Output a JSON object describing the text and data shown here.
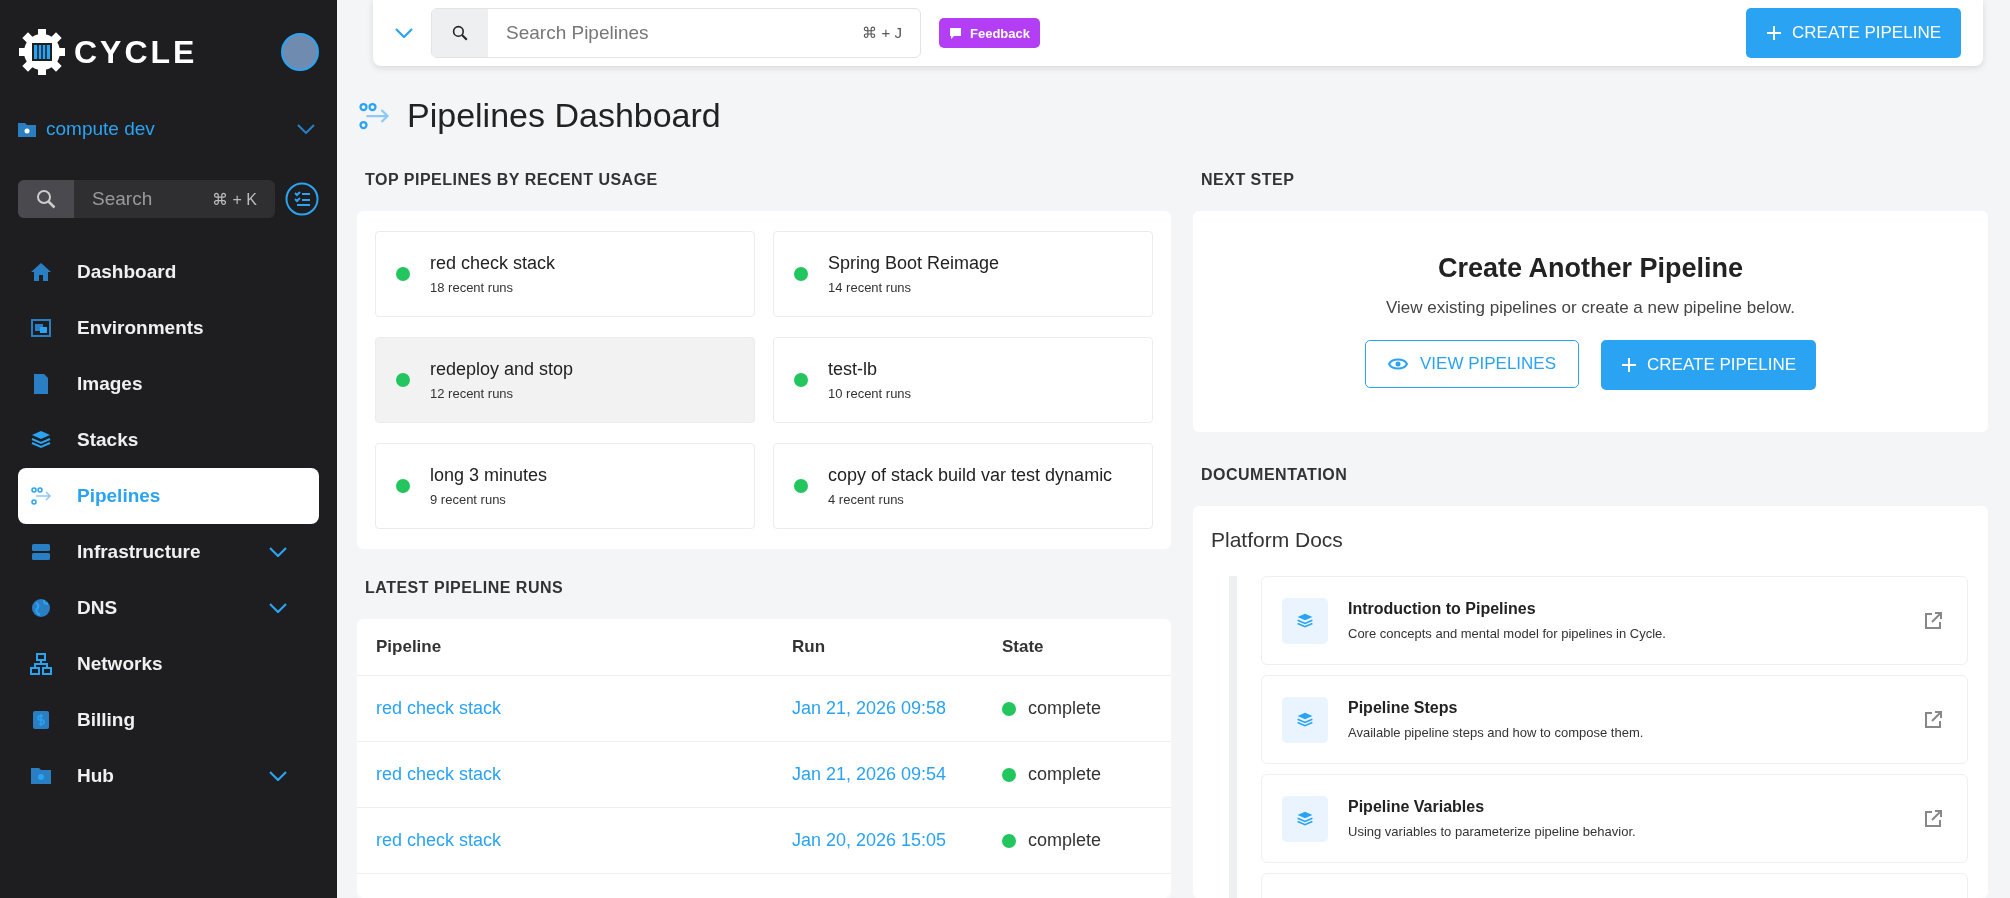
{
  "sidebar": {
    "brand": "CYCLE",
    "environment": "compute dev",
    "search": {
      "placeholder": "Search",
      "shortcut": "⌘ + K"
    },
    "items": [
      {
        "label": "Dashboard",
        "selected": false,
        "submenu": false
      },
      {
        "label": "Environments",
        "selected": false,
        "submenu": false
      },
      {
        "label": "Images",
        "selected": false,
        "submenu": false
      },
      {
        "label": "Stacks",
        "selected": false,
        "submenu": false
      },
      {
        "label": "Pipelines",
        "selected": true,
        "submenu": false
      },
      {
        "label": "Infrastructure",
        "selected": false,
        "submenu": true
      },
      {
        "label": "DNS",
        "selected": false,
        "submenu": true
      },
      {
        "label": "Networks",
        "selected": false,
        "submenu": false
      },
      {
        "label": "Billing",
        "selected": false,
        "submenu": false
      },
      {
        "label": "Hub",
        "selected": false,
        "submenu": true
      }
    ]
  },
  "topbar": {
    "search": {
      "placeholder": "Search Pipelines",
      "shortcut": "⌘ + J"
    },
    "feedback": "Feedback",
    "create": "CREATE PIPELINE"
  },
  "page_title": "Pipelines Dashboard",
  "top_pipelines": {
    "title": "TOP PIPELINES BY RECENT USAGE",
    "items": [
      {
        "name": "red check stack",
        "runs": "18 recent runs",
        "selected": false,
        "color": "#22c55e"
      },
      {
        "name": "Spring Boot Reimage",
        "runs": "14 recent runs",
        "selected": false,
        "color": "#22c55e"
      },
      {
        "name": "redeploy and stop",
        "runs": "12 recent runs",
        "selected": true,
        "color": "#22c55e"
      },
      {
        "name": "test-lb",
        "runs": "10 recent runs",
        "selected": false,
        "color": "#22c55e"
      },
      {
        "name": "long 3 minutes",
        "runs": "9 recent runs",
        "selected": false,
        "color": "#22c55e"
      },
      {
        "name": "copy of stack build var test dynamic",
        "runs": "4 recent runs",
        "selected": false,
        "color": "#22c55e"
      }
    ]
  },
  "latest_runs": {
    "title": "LATEST PIPELINE RUNS",
    "columns": [
      "Pipeline",
      "Run",
      "State"
    ],
    "rows": [
      {
        "pipeline": "red check stack",
        "run": "Jan 21, 2026 09:58",
        "state": "complete",
        "color": "#22c55e"
      },
      {
        "pipeline": "red check stack",
        "run": "Jan 21, 2026 09:54",
        "state": "complete",
        "color": "#22c55e"
      },
      {
        "pipeline": "red check stack",
        "run": "Jan 20, 2026 15:05",
        "state": "complete",
        "color": "#22c55e"
      }
    ]
  },
  "next_step": {
    "title": "NEXT STEP",
    "heading": "Create Another Pipeline",
    "text": "View existing pipelines or create a new pipeline below.",
    "view": "VIEW PIPELINES",
    "create": "CREATE PIPELINE"
  },
  "documentation": {
    "title": "DOCUMENTATION",
    "group": "Platform Docs",
    "items": [
      {
        "title": "Introduction to Pipelines",
        "text": "Core concepts and mental model for pipelines in Cycle."
      },
      {
        "title": "Pipeline Steps",
        "text": "Available pipeline steps and how to compose them."
      },
      {
        "title": "Pipeline Variables",
        "text": "Using variables to parameterize pipeline behavior."
      }
    ]
  }
}
